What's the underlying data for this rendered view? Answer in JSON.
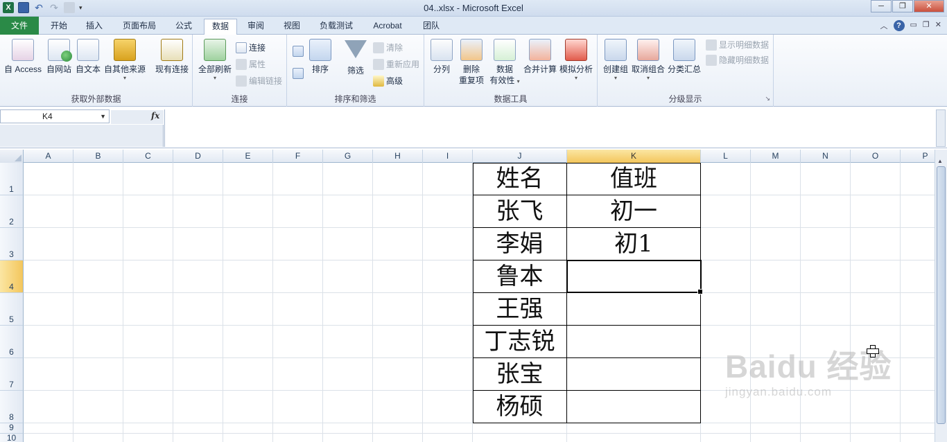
{
  "window": {
    "title": "04..xlsx  -  Microsoft Excel"
  },
  "ribbon_tabs": [
    "文件",
    "开始",
    "插入",
    "页面布局",
    "公式",
    "数据",
    "审阅",
    "视图",
    "负载测试",
    "Acrobat",
    "团队"
  ],
  "ribbon": {
    "groups": {
      "external_data": {
        "label": "获取外部数据",
        "btn_access": "自 Access",
        "btn_web": "自网站",
        "btn_text": "自文本",
        "btn_other": "自其他来源",
        "btn_existing": "现有连接"
      },
      "connections": {
        "label": "连接",
        "btn_refresh_all": "全部刷新",
        "btn_connections": "连接",
        "btn_properties": "属性",
        "btn_edit_links": "编辑链接"
      },
      "sort_filter": {
        "label": "排序和筛选",
        "btn_sort": "排序",
        "btn_filter": "筛选",
        "btn_clear": "清除",
        "btn_reapply": "重新应用",
        "btn_advanced": "高级"
      },
      "data_tools": {
        "label": "数据工具",
        "btn_text_to_columns": "分列",
        "btn_remove_dup_1": "删除",
        "btn_remove_dup_2": "重复项",
        "btn_validation_1": "数据",
        "btn_validation_2": "有效性",
        "btn_consolidate": "合并计算",
        "btn_whatif": "模拟分析"
      },
      "outline": {
        "label": "分级显示",
        "btn_group": "创建组",
        "btn_ungroup": "取消组合",
        "btn_subtotal": "分类汇总",
        "btn_show_detail": "显示明细数据",
        "btn_hide_detail": "隐藏明细数据"
      }
    }
  },
  "formula_bar": {
    "name_box": "K4",
    "fx_label": "fx",
    "formula": ""
  },
  "sheet": {
    "columns": [
      "A",
      "B",
      "C",
      "D",
      "E",
      "F",
      "G",
      "H",
      "I",
      "J",
      "K",
      "L",
      "M",
      "N",
      "O",
      "P"
    ],
    "rows": [
      "1",
      "2",
      "3",
      "4",
      "5",
      "6",
      "7",
      "8",
      "9",
      "10"
    ],
    "selected_cell": "K4",
    "table": [
      {
        "name": "姓名",
        "duty": "值班"
      },
      {
        "name": "张飞",
        "duty": "初一"
      },
      {
        "name": "李娟",
        "duty": "初1"
      },
      {
        "name": "鲁本",
        "duty": ""
      },
      {
        "name": "王强",
        "duty": ""
      },
      {
        "name": "丁志锐",
        "duty": ""
      },
      {
        "name": "张宝",
        "duty": ""
      },
      {
        "name": "杨硕",
        "duty": ""
      }
    ]
  },
  "watermark": {
    "logo": "Baidu 经验",
    "url": "jingyan.baidu.com"
  },
  "colors": {
    "file_tab": "#2a8a47",
    "selected_header": "#f3c65c"
  }
}
